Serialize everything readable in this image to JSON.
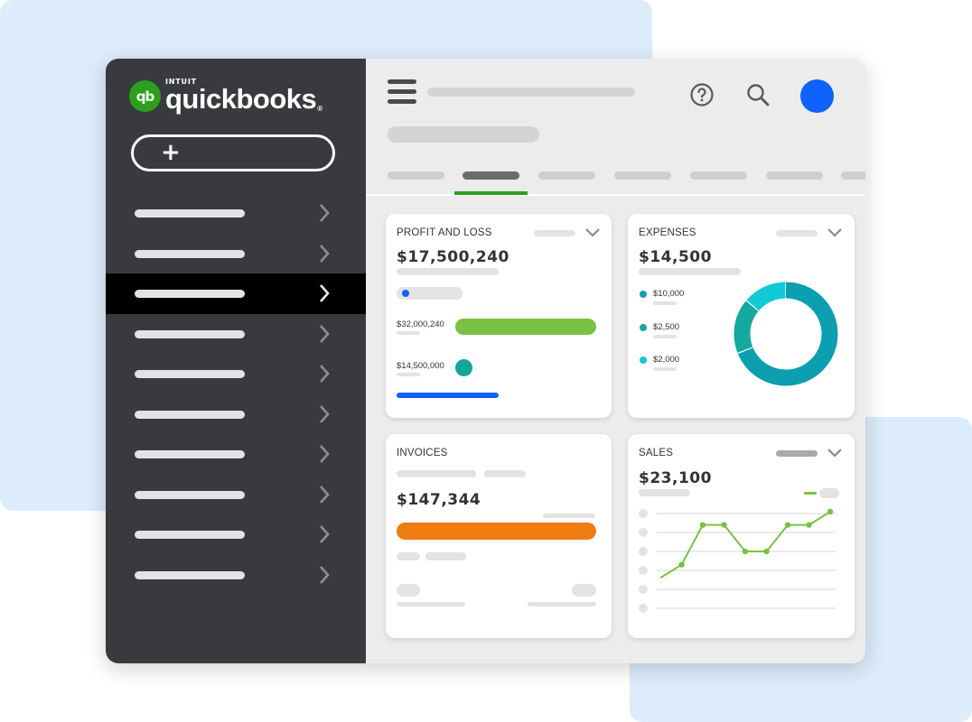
{
  "brand": {
    "intuit": "INTUIT",
    "name": "quickbooks",
    "badge": "qb",
    "registered": "®"
  },
  "sidebar": {
    "new_button_label": "+",
    "items": [
      {
        "id": 1,
        "active": false
      },
      {
        "id": 2,
        "active": false
      },
      {
        "id": 3,
        "active": true
      },
      {
        "id": 4,
        "active": false
      },
      {
        "id": 5,
        "active": false
      },
      {
        "id": 6,
        "active": false
      },
      {
        "id": 7,
        "active": false
      },
      {
        "id": 8,
        "active": false
      },
      {
        "id": 9,
        "active": false
      },
      {
        "id": 10,
        "active": false
      }
    ]
  },
  "colors": {
    "brand_green": "#2ca01c",
    "sidebar_bg": "#393a3d",
    "avatar_blue": "#0d63fb",
    "pl_green": "#7ac143",
    "pl_teal": "#12a699",
    "pl_blue": "#0d63fb",
    "invoice_orange": "#f07b10",
    "expense_teal_dark": "#0b9fb0",
    "expense_teal_mid": "#13a8a0",
    "expense_teal_light": "#12c9d6",
    "sales_green": "#7ac143"
  },
  "icons": {
    "help": "help-circle-icon",
    "search": "magnifier-icon",
    "menu": "hamburger-icon"
  },
  "cards": {
    "profit_loss": {
      "title": "PROFIT AND LOSS",
      "amount": "$17,500,240",
      "income_label": "$32,000,240",
      "expense_label": "$14,500,000",
      "income_fraction": 1.0,
      "expense_fraction": 0.05
    },
    "expenses": {
      "title": "EXPENSES",
      "amount": "$14,500",
      "items": [
        {
          "label": "$10,000",
          "color": "#0b9fb0",
          "value": 10000
        },
        {
          "label": "$2,500",
          "color": "#13a8a0",
          "value": 2500
        },
        {
          "label": "$2,000",
          "color": "#12c9d6",
          "value": 2000
        }
      ]
    },
    "invoices": {
      "title": "INVOICES",
      "amount": "$147,344"
    },
    "sales": {
      "title": "SALES",
      "amount": "$23,100"
    }
  },
  "chart_data": {
    "type": "line",
    "x": [
      1,
      2,
      3,
      4,
      5,
      6,
      7,
      8,
      9
    ],
    "series": [
      {
        "values": [
          1,
          2,
          5,
          5,
          3,
          3,
          5,
          5,
          6
        ]
      }
    ],
    "ylim": [
      0,
      6
    ]
  }
}
